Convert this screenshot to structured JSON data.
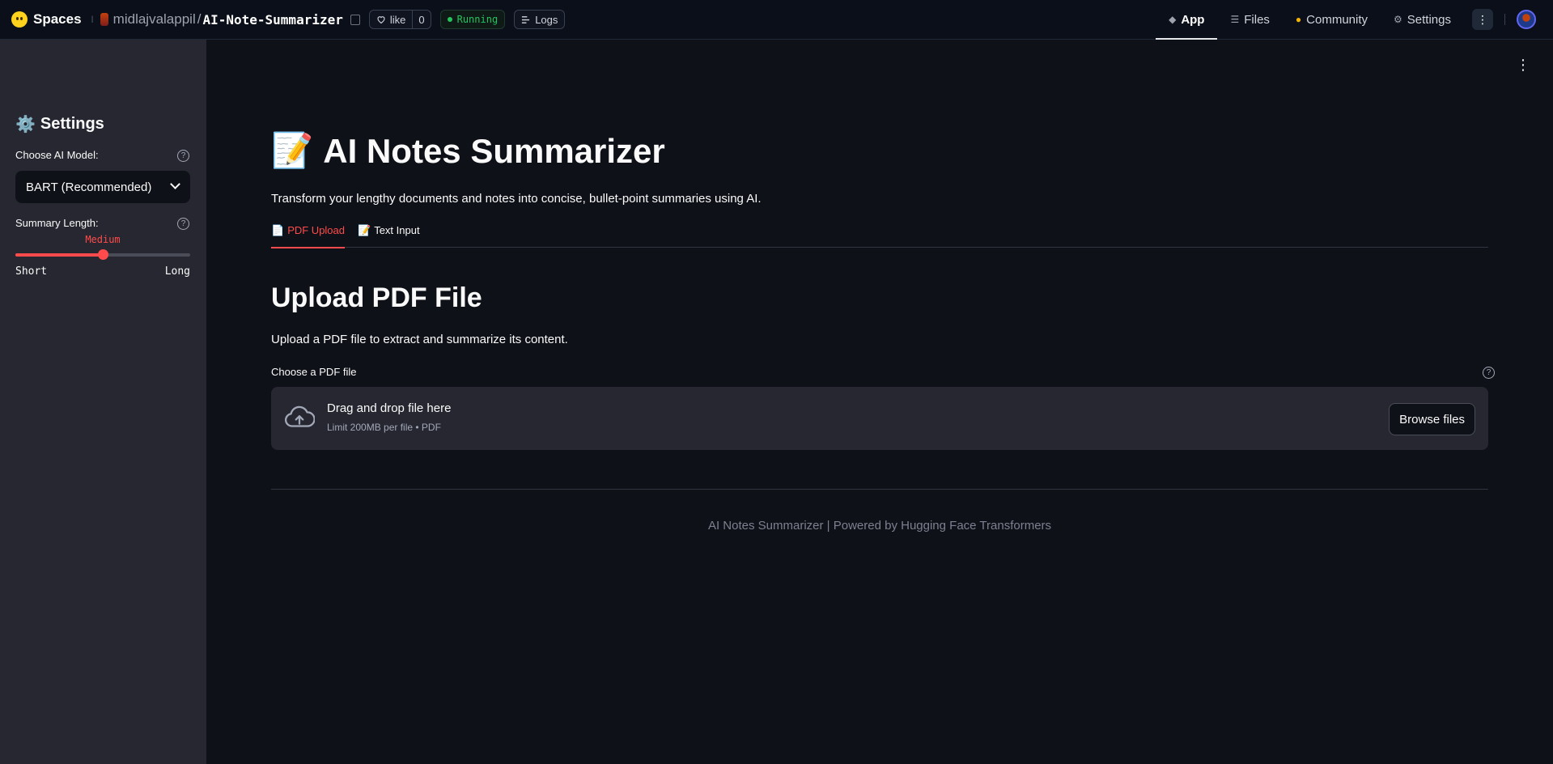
{
  "topbar": {
    "brand": "Spaces",
    "owner": "midlajvalappil",
    "slash": "/",
    "repo": "AI-Note-Summarizer",
    "like_label": "like",
    "like_count": "0",
    "status": "Running",
    "logs_label": "Logs",
    "nav": [
      {
        "label": "App",
        "icon": "cube-icon"
      },
      {
        "label": "Files",
        "icon": "files-icon"
      },
      {
        "label": "Community",
        "icon": "community-icon"
      },
      {
        "label": "Settings",
        "icon": "gear-icon"
      }
    ]
  },
  "sidebar": {
    "title": "Settings",
    "title_emoji": "⚙️",
    "model_label": "Choose AI Model:",
    "model_value": "BART (Recommended)",
    "length_label": "Summary Length:",
    "length_value": "Medium",
    "length_position": 0.5,
    "length_min": "Short",
    "length_max": "Long"
  },
  "main": {
    "title_emoji": "📝",
    "title": "AI Notes Summarizer",
    "subtitle": "Transform your lengthy documents and notes into concise, bullet-point summaries using AI.",
    "tabs": [
      {
        "emoji": "📄",
        "label": "PDF Upload",
        "active": true
      },
      {
        "emoji": "📝",
        "label": "Text Input",
        "active": false
      }
    ],
    "section_title": "Upload PDF File",
    "section_text": "Upload a PDF file to extract and summarize its content.",
    "uploader_label": "Choose a PDF file",
    "dropzone_title": "Drag and drop file here",
    "dropzone_sub": "Limit 200MB per file • PDF",
    "browse_label": "Browse files",
    "footer": "AI Notes Summarizer | Powered by Hugging Face Transformers"
  },
  "colors": {
    "accent": "#ff4b4b",
    "background": "#0e1117",
    "sidebar": "#262730",
    "running": "#22c55e"
  }
}
